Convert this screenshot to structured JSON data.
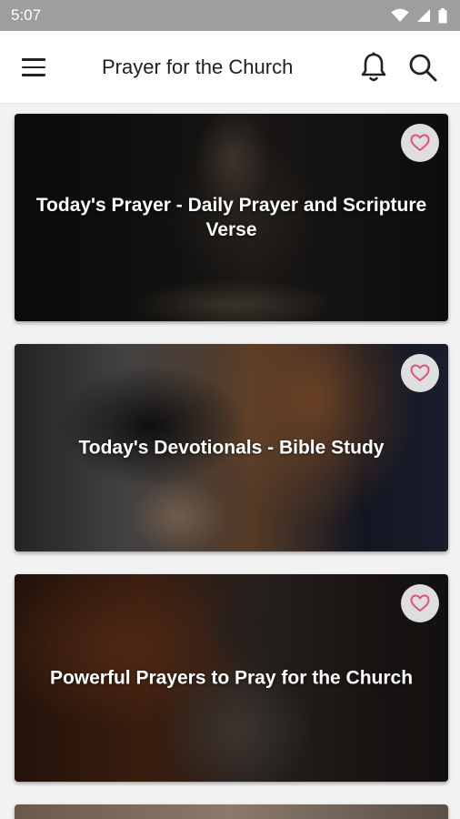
{
  "status_bar": {
    "time": "5:07",
    "icons": [
      "wifi-icon",
      "signal-icon",
      "battery-icon"
    ]
  },
  "app_bar": {
    "title": "Prayer for the Church",
    "menu_icon": "menu-icon",
    "notification_icon": "bell-icon",
    "search_icon": "search-icon"
  },
  "cards": [
    {
      "title": "Today's Prayer - Daily Prayer and Scripture Verse",
      "favorite_icon": "heart-outline-icon"
    },
    {
      "title": "Today's Devotionals - Bible Study",
      "favorite_icon": "heart-outline-icon"
    },
    {
      "title": "Powerful Prayers to Pray for the Church",
      "favorite_icon": "heart-outline-icon"
    },
    {
      "title": "",
      "favorite_icon": "heart-outline-icon"
    }
  ],
  "colors": {
    "status_bar": "#9e9e9e",
    "app_bar": "#ffffff",
    "background": "#f2f2f2",
    "heart_accent": "#e0507a"
  }
}
